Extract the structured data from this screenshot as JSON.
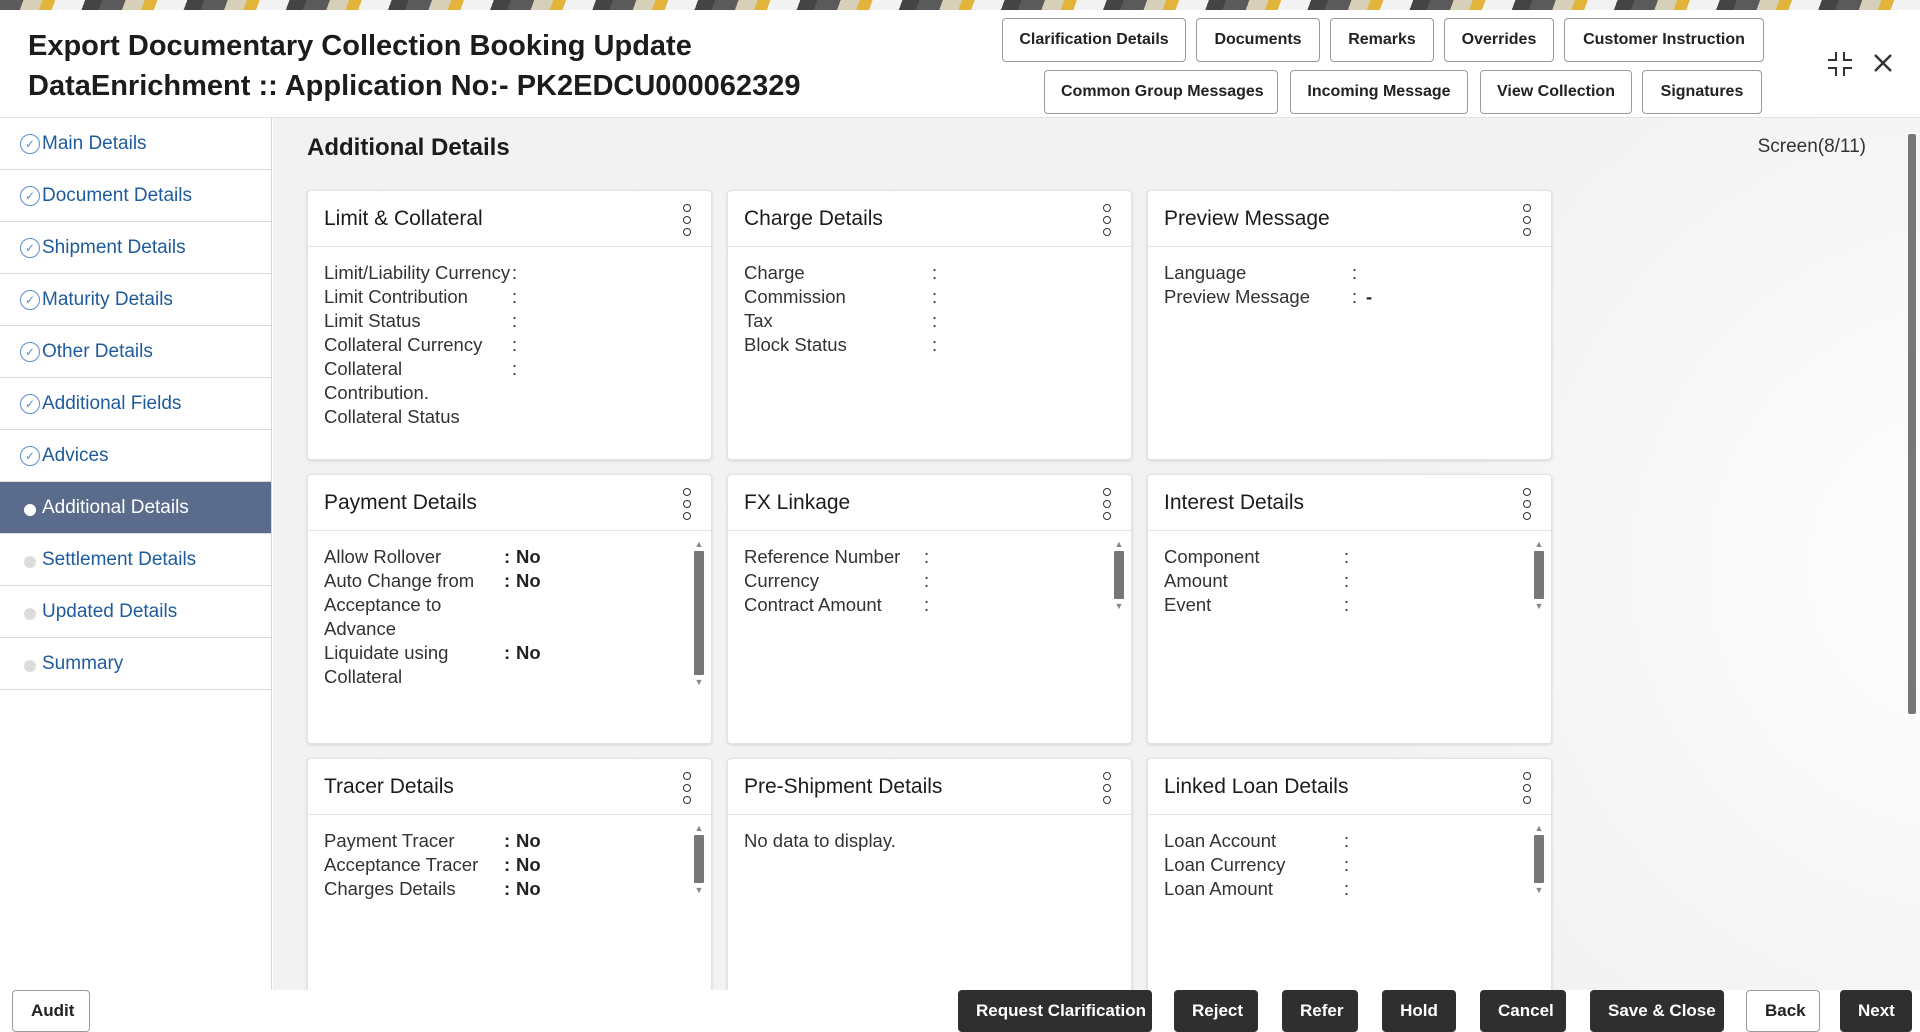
{
  "header": {
    "title_line1": "Export Documentary Collection Booking Update",
    "title_line2": "DataEnrichment :: Application No:- PK2EDCU000062329",
    "buttons_row1": [
      "Clarification Details",
      "Documents",
      "Remarks",
      "Overrides",
      "Customer Instruction"
    ],
    "buttons_row2": [
      "Common Group Messages",
      "Incoming Message",
      "View Collection",
      "Signatures"
    ]
  },
  "sidebar": {
    "items": [
      {
        "label": "Main Details",
        "state": "done"
      },
      {
        "label": "Document Details",
        "state": "done"
      },
      {
        "label": "Shipment Details",
        "state": "done"
      },
      {
        "label": "Maturity Details",
        "state": "done"
      },
      {
        "label": "Other Details",
        "state": "done"
      },
      {
        "label": "Additional Fields",
        "state": "done"
      },
      {
        "label": "Advices",
        "state": "done"
      },
      {
        "label": "Additional Details",
        "state": "active"
      },
      {
        "label": "Settlement Details",
        "state": "pending"
      },
      {
        "label": "Updated Details",
        "state": "pending"
      },
      {
        "label": "Summary",
        "state": "pending"
      }
    ]
  },
  "main": {
    "section_title": "Additional Details",
    "screen": "Screen(8/11)",
    "cards": {
      "limit": {
        "title": "Limit & Collateral",
        "rows": [
          {
            "label": "Limit/Liability Currency",
            "value": ""
          },
          {
            "label": "Limit Contribution",
            "value": ""
          },
          {
            "label": "Limit Status",
            "value": ""
          },
          {
            "label": "Collateral Currency",
            "value": ""
          },
          {
            "label": "Collateral Contribution.",
            "value": ""
          }
        ],
        "extra": "Collateral Status"
      },
      "charge": {
        "title": "Charge Details",
        "rows": [
          {
            "label": "Charge",
            "value": ""
          },
          {
            "label": "Commission",
            "value": ""
          },
          {
            "label": "Tax",
            "value": ""
          },
          {
            "label": "Block Status",
            "value": ""
          }
        ]
      },
      "preview": {
        "title": "Preview Message",
        "rows": [
          {
            "label": "Language",
            "value": ""
          },
          {
            "label": "Preview Message",
            "value": "-"
          }
        ]
      },
      "payment": {
        "title": "Payment Details",
        "rows": [
          {
            "label": "Allow Rollover",
            "value": "No"
          },
          {
            "label": "Auto Change from Acceptance to Advance",
            "value": "No"
          },
          {
            "label": "Liquidate using Collateral",
            "value": "No"
          }
        ]
      },
      "fx": {
        "title": "FX Linkage",
        "rows": [
          {
            "label": "Reference Number",
            "value": ""
          },
          {
            "label": "Currency",
            "value": ""
          },
          {
            "label": "Contract Amount",
            "value": ""
          }
        ]
      },
      "interest": {
        "title": "Interest Details",
        "rows": [
          {
            "label": "Component",
            "value": ""
          },
          {
            "label": "Amount",
            "value": ""
          },
          {
            "label": "Event",
            "value": ""
          }
        ]
      },
      "tracer": {
        "title": "Tracer Details",
        "rows": [
          {
            "label": "Payment Tracer",
            "value": "No"
          },
          {
            "label": "Acceptance Tracer",
            "value": "No"
          },
          {
            "label": "Charges Details",
            "value": "No"
          }
        ]
      },
      "preship": {
        "title": "Pre-Shipment Details",
        "empty": "No data to display."
      },
      "loan": {
        "title": "Linked Loan Details",
        "rows": [
          {
            "label": "Loan Account",
            "value": ""
          },
          {
            "label": "Loan Currency",
            "value": ""
          },
          {
            "label": "Loan Amount",
            "value": ""
          }
        ]
      }
    }
  },
  "footer": {
    "audit": "Audit",
    "request_clarification": "Request Clarification",
    "reject": "Reject",
    "refer": "Refer",
    "hold": "Hold",
    "cancel": "Cancel",
    "save_close": "Save & Close",
    "back": "Back",
    "next": "Next"
  },
  "colors": {
    "sidebar_active": "#5a6b8c",
    "link": "#1f5b9c",
    "primary_button": "#2f2f2f"
  }
}
